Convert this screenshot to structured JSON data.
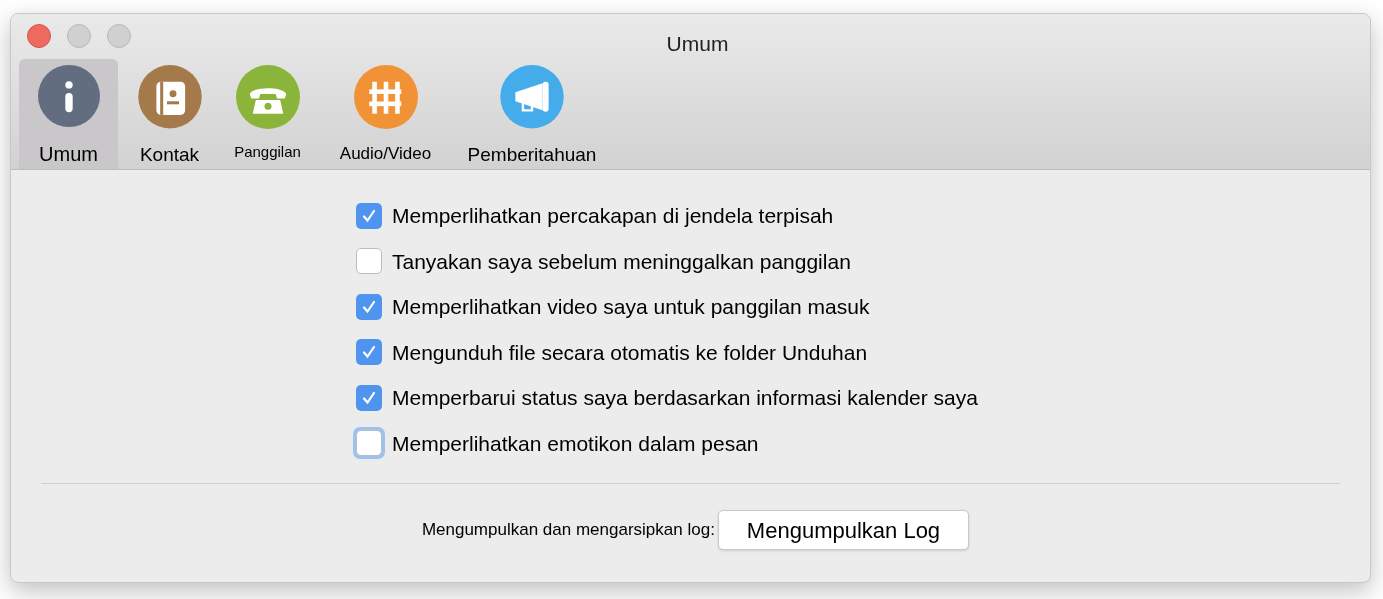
{
  "window": {
    "title": "Umum"
  },
  "tabs": [
    {
      "label": "Umum",
      "selected": true,
      "color": "#626d80"
    },
    {
      "label": "Kontak",
      "selected": false,
      "color": "#a57a4a"
    },
    {
      "label": "Panggilan",
      "selected": false,
      "color": "#8ab43a"
    },
    {
      "label": "Audio/Video",
      "selected": false,
      "color": "#f29236"
    },
    {
      "label": "Pemberitahuan",
      "selected": false,
      "color": "#45acec"
    }
  ],
  "options": [
    {
      "label": "Memperlihatkan percakapan di jendela terpisah",
      "checked": true,
      "focused": false
    },
    {
      "label": "Tanyakan saya sebelum meninggalkan panggilan",
      "checked": false,
      "focused": false
    },
    {
      "label": "Memperlihatkan video saya untuk panggilan masuk",
      "checked": true,
      "focused": false
    },
    {
      "label": "Mengunduh file secara otomatis ke folder Unduhan",
      "checked": true,
      "focused": false
    },
    {
      "label": "Memperbarui status saya berdasarkan informasi kalender saya",
      "checked": true,
      "focused": false
    },
    {
      "label": "Memperlihatkan emotikon dalam pesan",
      "checked": false,
      "focused": true
    }
  ],
  "logs": {
    "label": "Mengumpulkan dan mengarsipkan log:",
    "button": "Mengumpulkan Log"
  }
}
